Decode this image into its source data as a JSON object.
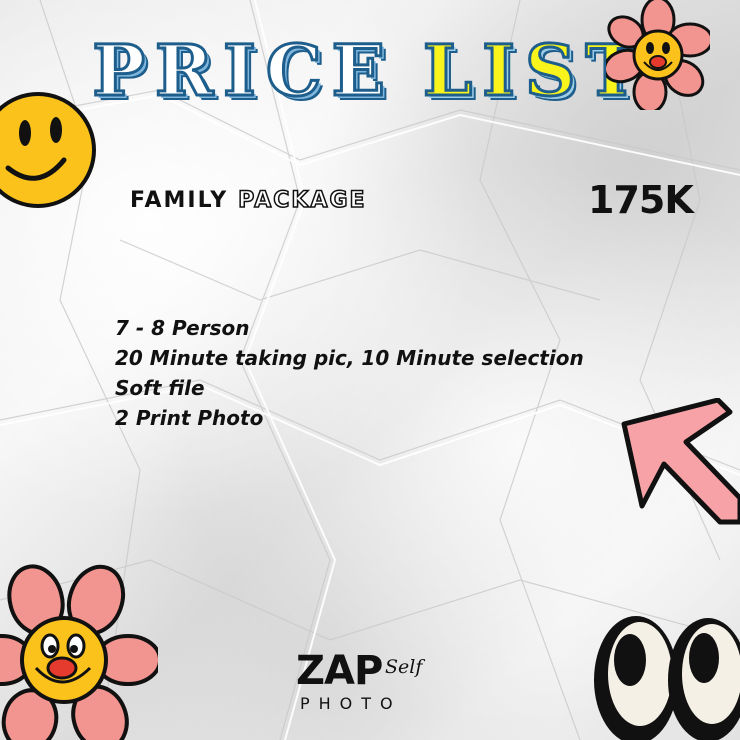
{
  "title": {
    "word1": "PRICE",
    "word2": "LIST"
  },
  "package": {
    "name_plain": "FAMILY",
    "name_outlined": "PACKAGE",
    "price": "175K"
  },
  "details": [
    "7 - 8 Person",
    "20 Minute taking pic, 10 Minute selection",
    "Soft file",
    "2 Print Photo"
  ],
  "logo": {
    "main": "ZAP",
    "script": "Self",
    "sub": "PHOTO"
  },
  "colors": {
    "title_stroke": "#1e5e8c",
    "title_yellow": "#f9f51c",
    "smiley_yellow": "#fbc21b",
    "flower_pink": "#f2948f",
    "arrow_pink": "#f7a2a6"
  },
  "icons": [
    "smiley-face-icon",
    "flower-face-icon",
    "arrow-icon",
    "cartoon-eyes-icon"
  ]
}
